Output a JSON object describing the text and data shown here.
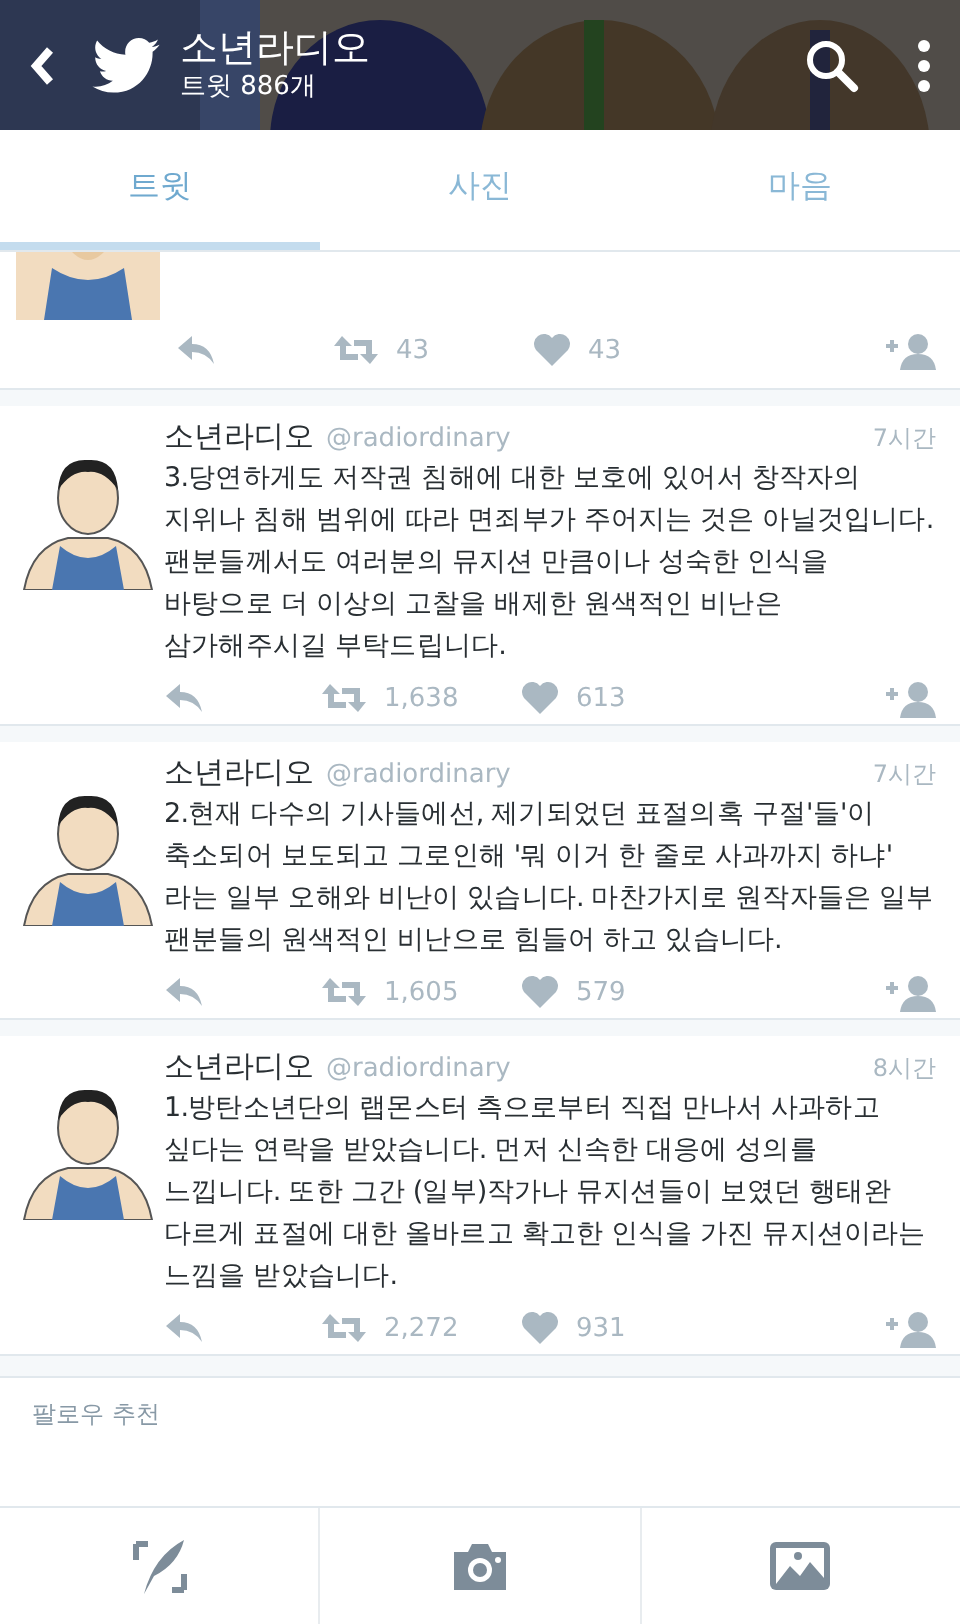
{
  "header": {
    "title": "소년라디오",
    "tweet_count": "트윗 886개"
  },
  "tabs": [
    {
      "label": "트윗",
      "selected": true
    },
    {
      "label": "사진",
      "selected": false
    },
    {
      "label": "마음",
      "selected": false
    }
  ],
  "partial_tweet": {
    "retweets": "43",
    "likes": "43"
  },
  "tweets": [
    {
      "name": "소년라디오",
      "handle": "@radiordinary",
      "time": "7시간",
      "text": "3.당연하게도 저작권 침해에 대한 보호에 있어서 창작자의 지위나 침해 범위에 따라 면죄부가 주어지는 것은 아닐것입니다. 팬분들께서도 여러분의 뮤지션 만큼이나 성숙한 인식을 바탕으로 더 이상의 고찰을 배제한 원색적인 비난은 삼가해주시길 부탁드립니다.",
      "retweets": "1,638",
      "likes": "613"
    },
    {
      "name": "소년라디오",
      "handle": "@radiordinary",
      "time": "7시간",
      "text": "2.현재 다수의 기사들에선, 제기되었던 표절의혹 구절'들'이 축소되어 보도되고 그로인해 '뭐 이거 한 줄로 사과까지 하냐' 라는 일부 오해와 비난이 있습니다. 마찬가지로 원작자들은 일부 팬분들의 원색적인 비난으로 힘들어 하고 있습니다.",
      "retweets": "1,605",
      "likes": "579"
    },
    {
      "name": "소년라디오",
      "handle": "@radiordinary",
      "time": "8시간",
      "text": "1.방탄소년단의 랩몬스터 측으로부터 직접 만나서 사과하고 싶다는 연락을 받았습니다. 먼저 신속한 대응에 성의를 느낍니다. 또한 그간 (일부)작가나 뮤지션들이 보였던 행태완 다르게 표절에 대한 올바르고 확고한 인식을 가진 뮤지션이라는 느낌을 받았습니다.",
      "retweets": "2,272",
      "likes": "931"
    }
  ],
  "suggestions": {
    "heading": "팔로우 추천"
  }
}
